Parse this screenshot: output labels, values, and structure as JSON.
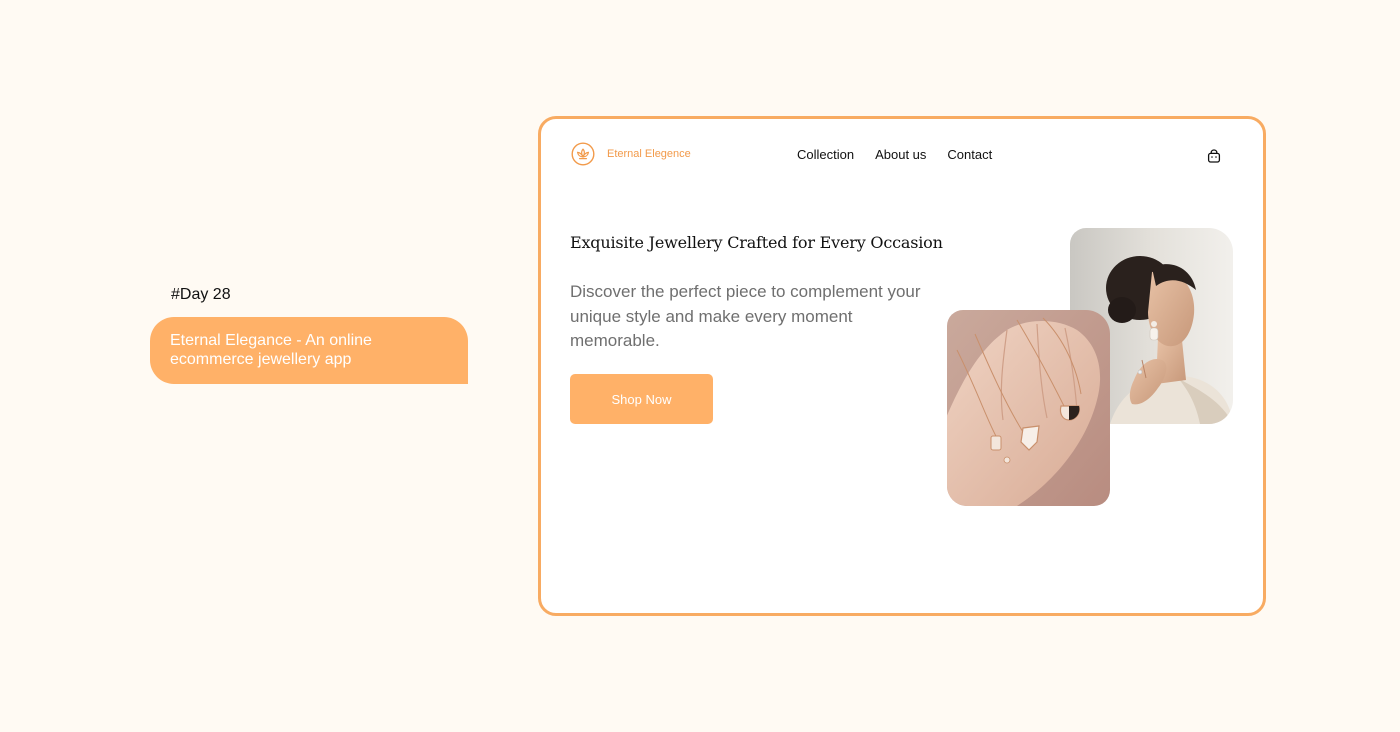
{
  "caption": {
    "day": "#Day 28",
    "description": "Eternal Elegance - An online ecommerce jewellery app"
  },
  "header": {
    "brand": "Eternal Elegence",
    "logo_icon": "lotus-icon",
    "nav": [
      {
        "label": "Collection"
      },
      {
        "label": "About us"
      },
      {
        "label": "Contact"
      }
    ],
    "cart_icon": "shopping-bag-icon"
  },
  "hero": {
    "title": "Exquisite Jewellery Crafted for Every Occasion",
    "description": "Discover the perfect piece to complement your unique style and make every moment memorable.",
    "cta": "Shop Now"
  },
  "images": {
    "woman": "woman-wearing-earrings-photo",
    "hand": "hand-holding-necklaces-photo"
  },
  "colors": {
    "accent": "#ffb168",
    "border": "#f8ab62",
    "page_background": "#fffaf3",
    "brand_text": "#f29a4a"
  }
}
